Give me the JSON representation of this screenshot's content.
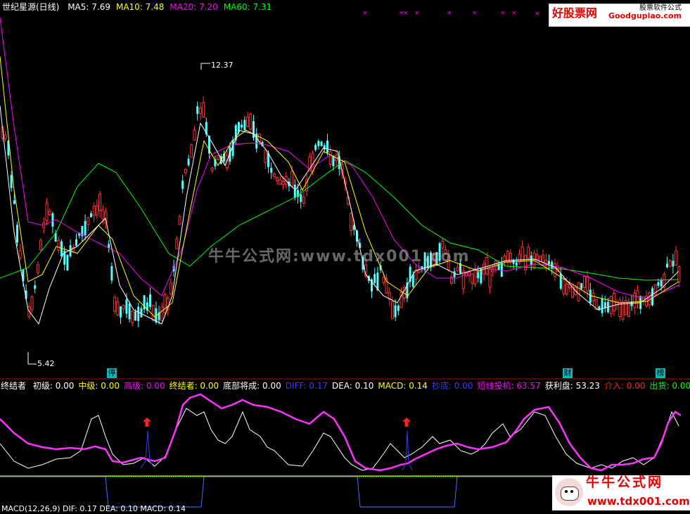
{
  "header": {
    "title": "世纪星源(日线)",
    "ma": [
      {
        "label": "MA5: 7.69",
        "color": "#ffffff"
      },
      {
        "label": "MA10: 7.48",
        "color": "#ffff00"
      },
      {
        "label": "MA20: 7.20",
        "color": "#ff00ff"
      },
      {
        "label": "MA60: 7.31",
        "color": "#00ff00"
      }
    ]
  },
  "price_labels": {
    "high": "12.37",
    "low": "5.42"
  },
  "markers": {
    "stop": "停",
    "finance": "财",
    "list": "榜"
  },
  "indicator": {
    "name": "终结者",
    "items": [
      {
        "label": "初级: 0.00",
        "color": "#ffffff"
      },
      {
        "label": "中级: 0.00",
        "color": "#ffff00"
      },
      {
        "label": "高级: 0.00",
        "color": "#ff00ff"
      },
      {
        "label": "终结者: 0.00",
        "color": "#ffff00"
      },
      {
        "label": "底部将成: 0.00",
        "color": "#ffffff"
      },
      {
        "label": "DIFF: 0.17",
        "color": "#3a3aff"
      },
      {
        "label": "DEA: 0.10",
        "color": "#ffffff"
      },
      {
        "label": "MACD: 0.14",
        "color": "#ffff00"
      },
      {
        "label": "抄底: 0.00",
        "color": "#3a3aff"
      },
      {
        "label": "短线投机: 63.57",
        "color": "#ff00ff"
      },
      {
        "label": "获利盘: 53.23",
        "color": "#ffffff"
      },
      {
        "label": "介入: 0.00",
        "color": "#ff2020"
      },
      {
        "label": "出货: 0.00",
        "color": "#00ff00"
      }
    ]
  },
  "bottom_label": "MACD(12,26,9) DIF: 0.17 DEA: 0.10 MACD: 0.14",
  "watermark": {
    "center": "牛牛公式网:www.tdx001.com",
    "corner_title": "牛牛公式网",
    "corner_url": "www.tdx001.com"
  },
  "logo": {
    "main": "好股票网",
    "sub": "Goodgupiao.com",
    "tag": "股票软件公式"
  },
  "colors": {
    "up": "#ff3232",
    "down": "#54ffff",
    "ma5": "#ffffff",
    "ma10": "#ffff00",
    "ma20": "#ff00ff",
    "ma60": "#00ff00",
    "border": "#b00000"
  }
}
